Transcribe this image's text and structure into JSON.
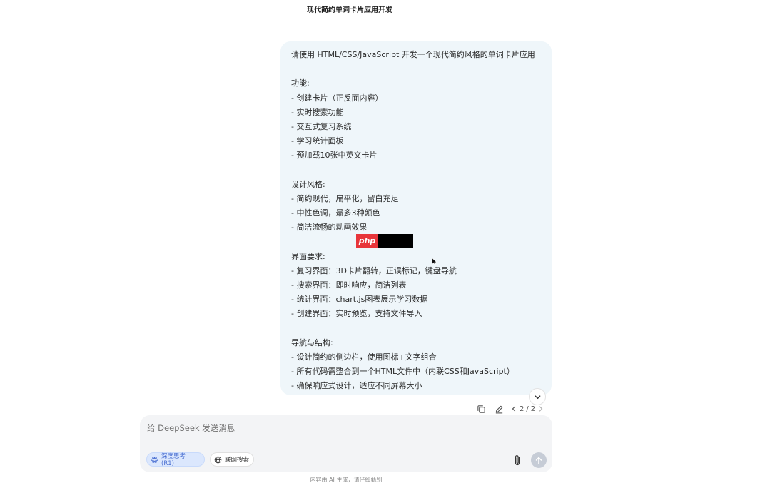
{
  "chat": {
    "title": "现代简约单词卡片应用开发"
  },
  "message": {
    "lines": [
      "请使用 HTML/CSS/JavaScript 开发一个现代简约风格的单词卡片应用",
      "",
      "功能:",
      "- 创建卡片（正反面内容）",
      "- 实时搜索功能",
      "- 交互式复习系统",
      "- 学习统计面板",
      "- 预加载10张中英文卡片",
      "",
      "设计风格:",
      "- 简约现代，扁平化，留白充足",
      "- 中性色调，最多3种颜色",
      "- 简洁流畅的动画效果",
      "",
      "界面要求:",
      "- 复习界面：3D卡片翻转，正误标记，键盘导航",
      "- 搜索界面：即时响应，简洁列表",
      "- 统计界面：chart.js图表展示学习数据",
      "- 创建界面：实时预览，支持文件导入",
      "",
      "导航与结构:",
      "- 设计简约的侧边栏，使用图标+文字组合",
      "- 所有代码需整合到一个HTML文件中（内联CSS和JavaScript）",
      "- 确保响应式设计，适应不同屏幕大小"
    ],
    "watermark_text": "php",
    "pager": {
      "current": "2",
      "separator": "/",
      "total": "2"
    },
    "icons": {
      "copy": "copy-icon",
      "edit": "edit-icon",
      "prev": "chevron-left-icon",
      "next": "chevron-right-icon",
      "scroll": "chevron-down-icon"
    }
  },
  "composer": {
    "placeholder": "给 DeepSeek 发送消息",
    "deep_think_label": "深度思考 (R1)",
    "web_search_label": "联网搜索",
    "icons": {
      "attach": "paperclip-icon",
      "send": "arrow-up-icon",
      "deep": "atom-icon",
      "web": "globe-icon"
    }
  },
  "footer": {
    "note": "内容由 AI 生成，请仔细甄别"
  },
  "colors": {
    "bubble_bg": "#eff6fa",
    "composer_bg": "#f3f4f6",
    "chip_active_bg": "#dbe7fd",
    "chip_active_text": "#4a6fd1",
    "send_disabled": "#c6ccd6",
    "watermark_red": "#e8353a"
  }
}
